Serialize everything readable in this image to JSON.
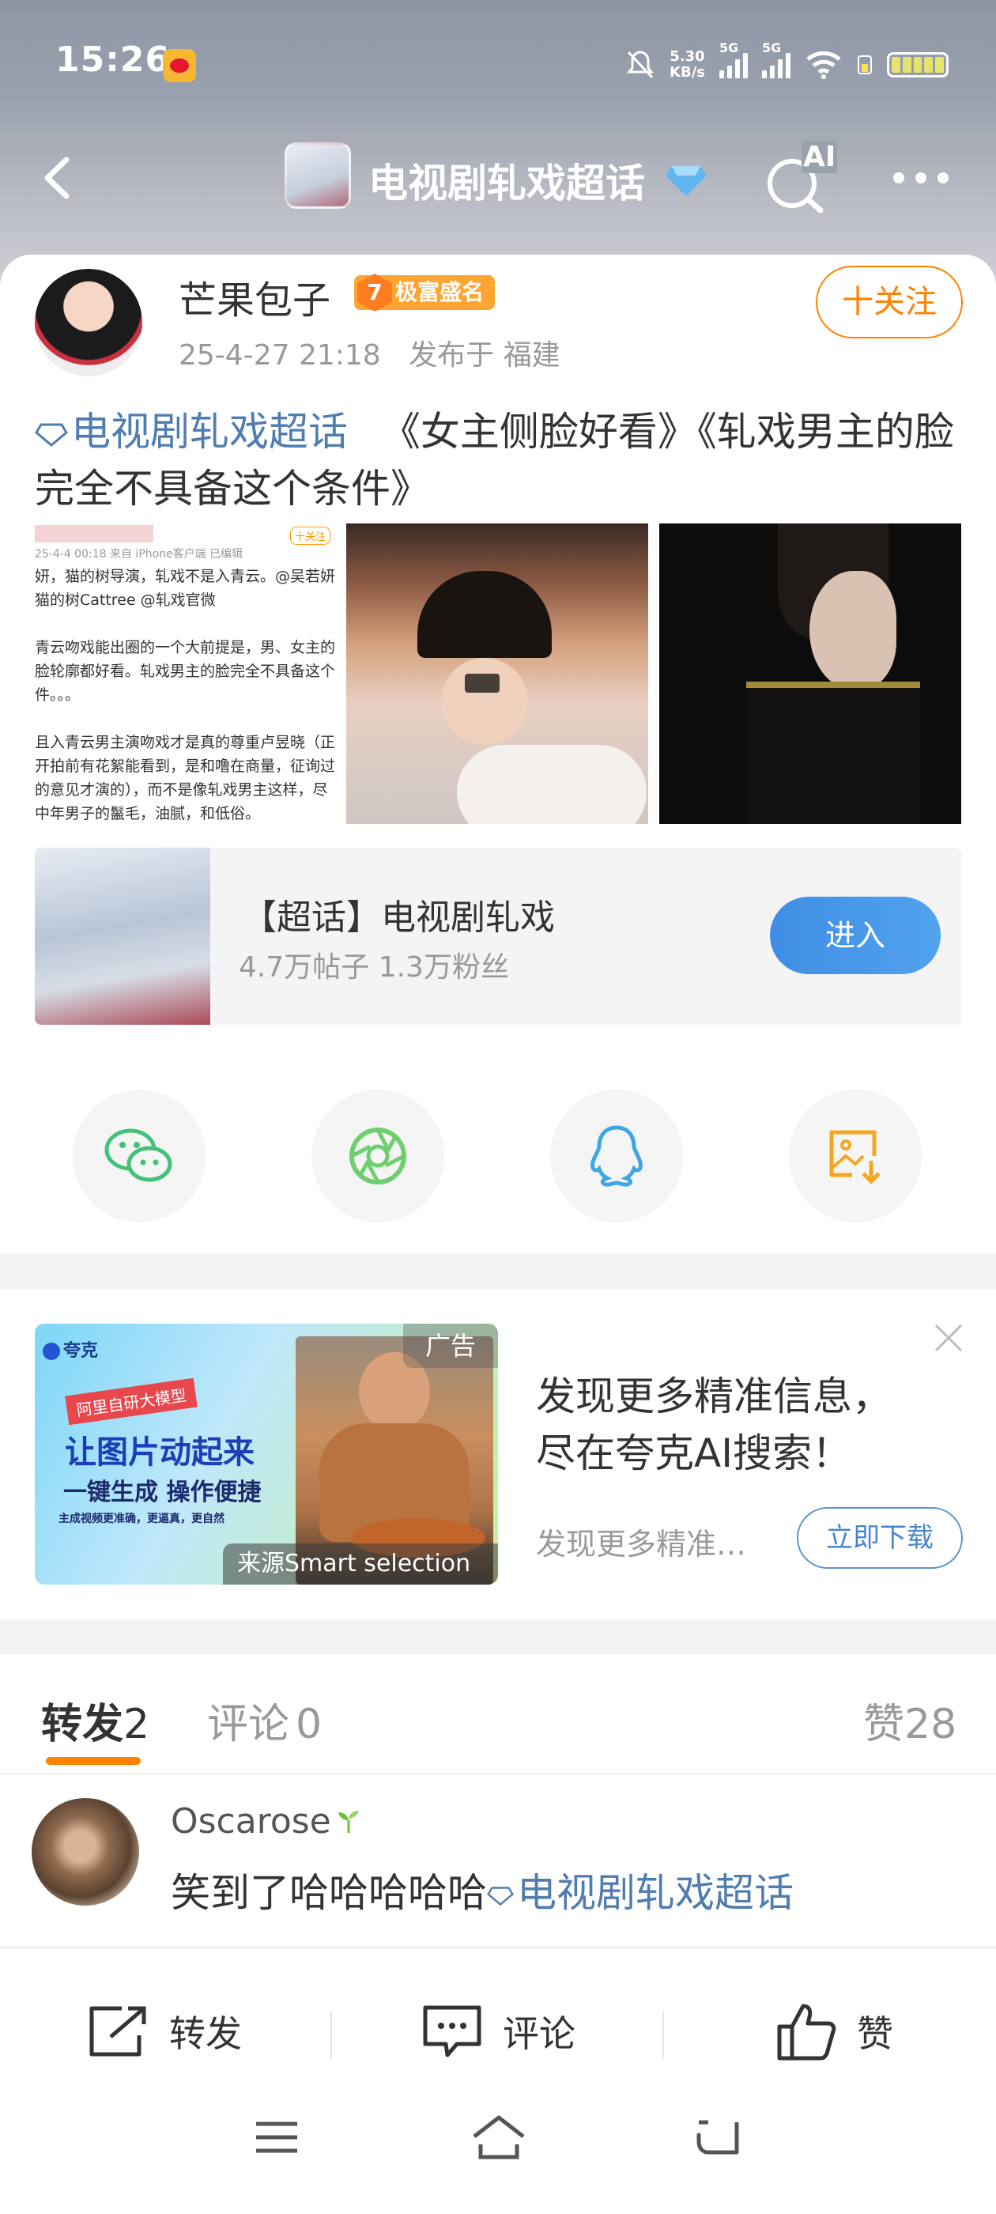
{
  "status_bar": {
    "time": "15:26",
    "net_speed_value": "5.30",
    "net_speed_unit": "KB/s",
    "sim1": "5G",
    "sim2": "5G",
    "battery_color": "#e8e26e"
  },
  "nav": {
    "title": "电视剧轧戏超话",
    "ai_label": "AI",
    "icons": [
      "back-arrow-icon",
      "diamond-icon",
      "ai-search-icon",
      "more-dots-icon"
    ]
  },
  "post": {
    "username": "芒果包子",
    "badge_level": "7",
    "badge_text": "极富盛名",
    "datetime": "25-4-27 21:18",
    "location_prefix": "发布于",
    "location": "福建",
    "follow_label": "十关注",
    "topic_link": "电视剧轧戏超话",
    "body": "《女主侧脸好看》《轧戏男主的脸完全不具备这个条件》",
    "image1_lines": [
      "妍，猫的树导演，轧戏不是入青云。@吴若妍",
      "猫的树Cattree @轧戏官微",
      "",
      "青云吻戏能出圈的一个大前提是，男、女主的",
      "脸轮廓都好看。轧戏男主的脸完全不具备这个",
      "件。。。",
      "",
      "且入青云男主演吻戏才是真的尊重卢昱晓（正",
      "开拍前有花絮能看到，是和噜在商量，征询过",
      "的意见才演的），而不是像轧戏男主这样，尽",
      "中年男子的鬣毛，油腻，和低俗。"
    ],
    "image1_header": "25-4-4 00:18 来自 iPhone客户端 已编辑",
    "image1_follow": "十关注"
  },
  "topic_card": {
    "title": "【超话】电视剧轧戏",
    "stats": "4.7万帖子 1.3万粉丝",
    "enter_label": "进入"
  },
  "share_icons": [
    "wechat-icon",
    "moments-icon",
    "qq-icon",
    "save-image-icon"
  ],
  "ad": {
    "brand": "夸克",
    "tag": "广告",
    "ribbon": "阿里自研大模型",
    "headline1": "让图片动起来",
    "headline2": "一键生成 操作便捷",
    "small": "主成视频更准确，更逼真，更自然",
    "source": "来源Smart selection",
    "title_line1": "发现更多精准信息，",
    "title_line2": "尽在夸克AI搜索！",
    "sub": "发现更多精准…",
    "download_label": "立即下载"
  },
  "tabs": {
    "forward": "转发",
    "forward_count": "2",
    "comment": "评论",
    "comment_count": "0",
    "like": "赞",
    "like_count": "28"
  },
  "comment": {
    "username": "Oscarose",
    "text_prefix": "笑到了哈哈哈哈哈",
    "topic": "电视剧轧戏超话"
  },
  "bottom_bar": {
    "forward_label": "转发",
    "comment_label": "评论",
    "like_label": "赞"
  },
  "colors": {
    "accent_orange": "#ff8200",
    "link_blue": "#507daf",
    "enter_blue": "#4a95e9"
  }
}
